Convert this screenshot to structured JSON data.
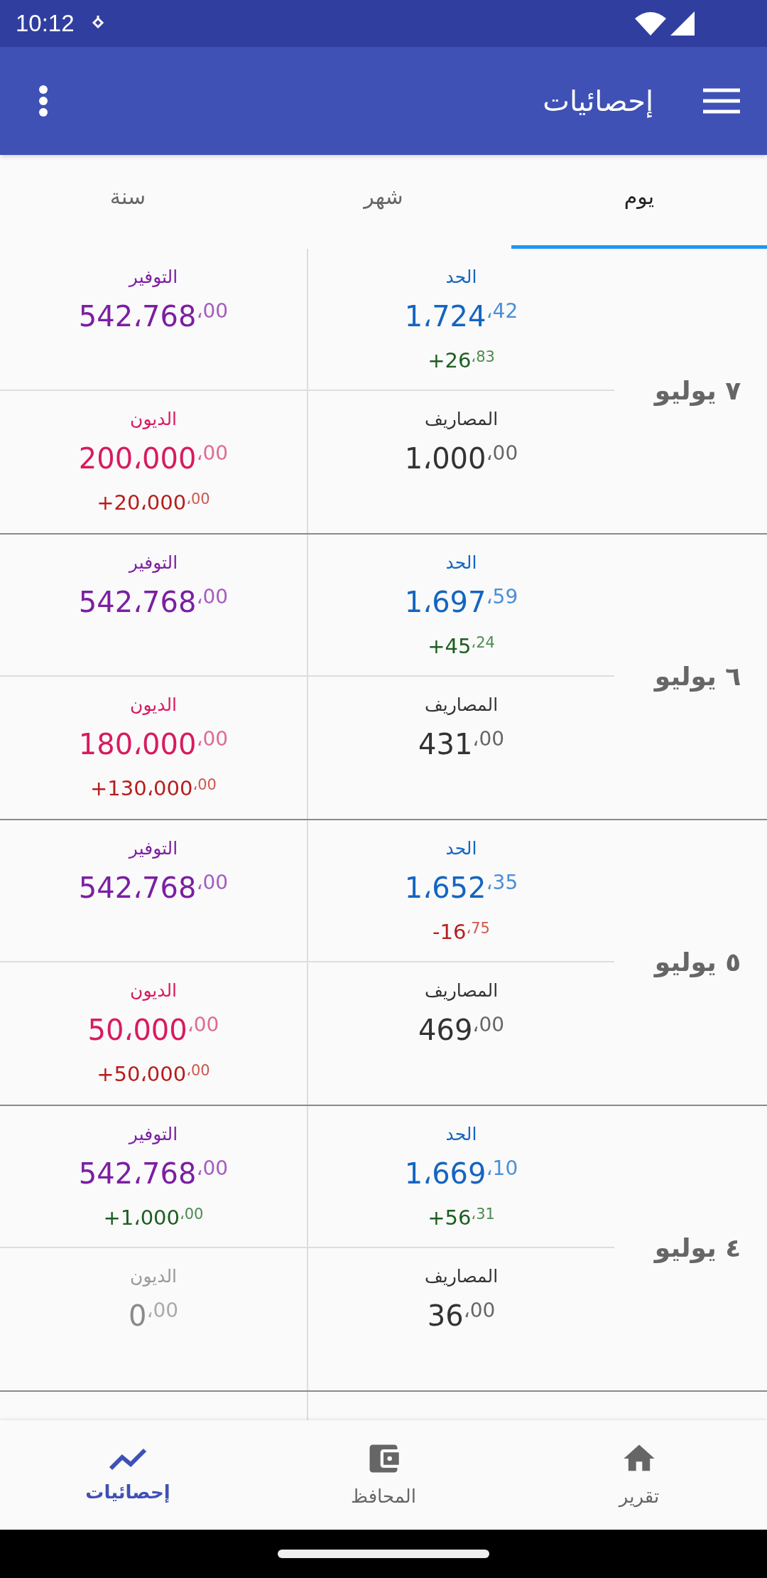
{
  "status_bar": {
    "time": "10:12"
  },
  "app_bar": {
    "title": "إحصائيات"
  },
  "tabs": [
    {
      "label": "يوم",
      "selected": true
    },
    {
      "label": "شهر",
      "selected": false
    },
    {
      "label": "سنة",
      "selected": false
    }
  ],
  "days": [
    {
      "date": "٧ يوليو",
      "cells": [
        {
          "kind": "limit",
          "label": "الحد",
          "value": "1،724",
          "decimals": "،42",
          "muted": false,
          "change": {
            "negative": false,
            "value": "+26",
            "decimals": "،83"
          }
        },
        {
          "kind": "savings",
          "label": "التوفير",
          "value": "542،768",
          "decimals": "،00",
          "muted": false
        },
        {
          "kind": "expenses",
          "label": "المصاريف",
          "value": "1،000",
          "decimals": "،00",
          "muted": false
        },
        {
          "kind": "debts",
          "label": "الديون",
          "value": "200،000",
          "decimals": "،00",
          "muted": false,
          "change": {
            "negative": true,
            "value": "+20،000",
            "decimals": "،00"
          }
        }
      ]
    },
    {
      "date": "٦ يوليو",
      "cells": [
        {
          "kind": "limit",
          "label": "الحد",
          "value": "1،697",
          "decimals": "،59",
          "muted": false,
          "change": {
            "negative": false,
            "value": "+45",
            "decimals": "،24"
          }
        },
        {
          "kind": "savings",
          "label": "التوفير",
          "value": "542،768",
          "decimals": "،00",
          "muted": false
        },
        {
          "kind": "expenses",
          "label": "المصاريف",
          "value": "431",
          "decimals": "،00",
          "muted": false
        },
        {
          "kind": "debts",
          "label": "الديون",
          "value": "180،000",
          "decimals": "،00",
          "muted": false,
          "change": {
            "negative": true,
            "value": "+130،000",
            "decimals": "،00"
          }
        }
      ]
    },
    {
      "date": "٥ يوليو",
      "cells": [
        {
          "kind": "limit",
          "label": "الحد",
          "value": "1،652",
          "decimals": "،35",
          "muted": false,
          "change": {
            "negative": true,
            "value": "-16",
            "decimals": "،75"
          }
        },
        {
          "kind": "savings",
          "label": "التوفير",
          "value": "542،768",
          "decimals": "،00",
          "muted": false
        },
        {
          "kind": "expenses",
          "label": "المصاريف",
          "value": "469",
          "decimals": "،00",
          "muted": false
        },
        {
          "kind": "debts",
          "label": "الديون",
          "value": "50،000",
          "decimals": "،00",
          "muted": false,
          "change": {
            "negative": true,
            "value": "+50،000",
            "decimals": "،00"
          }
        }
      ]
    },
    {
      "date": "٤ يوليو",
      "cells": [
        {
          "kind": "limit",
          "label": "الحد",
          "value": "1،669",
          "decimals": "،10",
          "muted": false,
          "change": {
            "negative": false,
            "value": "+56",
            "decimals": "،31"
          }
        },
        {
          "kind": "savings",
          "label": "التوفير",
          "value": "542،768",
          "decimals": "،00",
          "muted": false,
          "change": {
            "negative": false,
            "value": "+1،000",
            "decimals": "،00"
          }
        },
        {
          "kind": "expenses",
          "label": "المصاريف",
          "value": "36",
          "decimals": "،00",
          "muted": false
        },
        {
          "kind": "debts",
          "label": "الديون",
          "value": "0",
          "decimals": "،00",
          "muted": true
        }
      ]
    }
  ],
  "bottom_nav": [
    {
      "kind": "report",
      "label": "تقرير",
      "selected": false
    },
    {
      "kind": "wallets",
      "label": "المحافظ",
      "selected": false
    },
    {
      "kind": "stats",
      "label": "إحصائيات",
      "selected": true
    }
  ]
}
